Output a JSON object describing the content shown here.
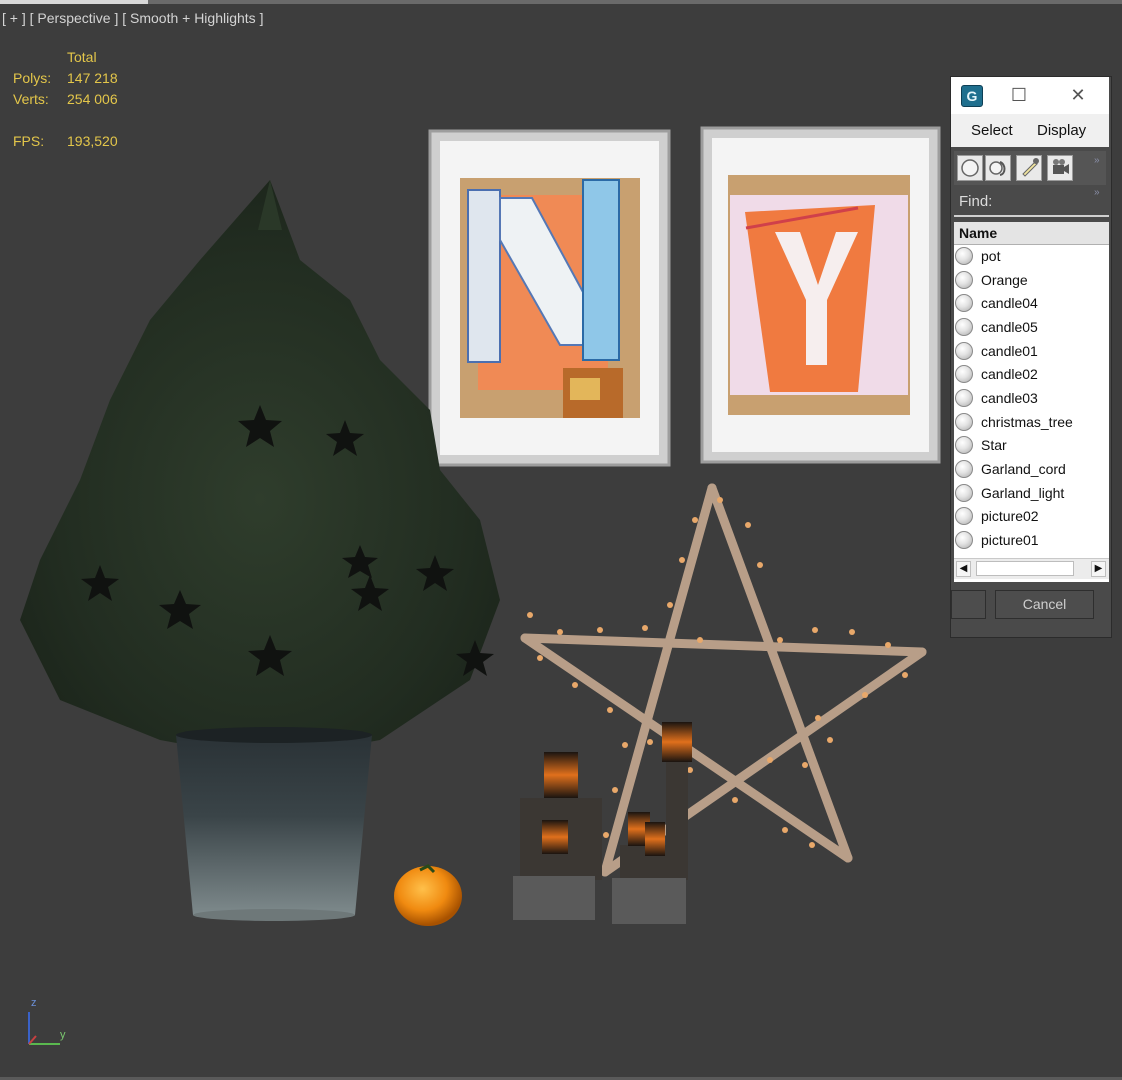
{
  "viewport": {
    "label": "[ + ] [ Perspective ] [ Smooth + Highlights ]",
    "stats": {
      "header": "Total",
      "polys_label": "Polys:",
      "polys_value": "147 218",
      "verts_label": "Verts:",
      "verts_value": "254 006",
      "fps_label": "FPS:",
      "fps_value": "193,520"
    },
    "axis": {
      "z": "z",
      "y": "y"
    }
  },
  "explorer": {
    "menu": {
      "select": "Select",
      "display": "Display"
    },
    "find_label": "Find:",
    "column_header": "Name",
    "items": [
      "pot",
      "Orange",
      "candle04",
      "candle05",
      "candle01",
      "candle02",
      "candle03",
      "christmas_tree",
      "Star",
      "Garland_cord",
      "Garland_light",
      "picture02",
      "picture01"
    ],
    "cancel_label": "Cancel",
    "icons": {
      "app": "3dsmax-icon",
      "maximize": "maximize-icon",
      "close": "close-icon",
      "tools": [
        "sphere-filter-icon",
        "shapes-filter-icon",
        "light-filter-icon",
        "camera-filter-icon"
      ]
    }
  },
  "colors": {
    "viewport_bg": "#3d3d3d",
    "stats_text": "#e3c64a",
    "dialog_bg": "#4a4a4a"
  }
}
